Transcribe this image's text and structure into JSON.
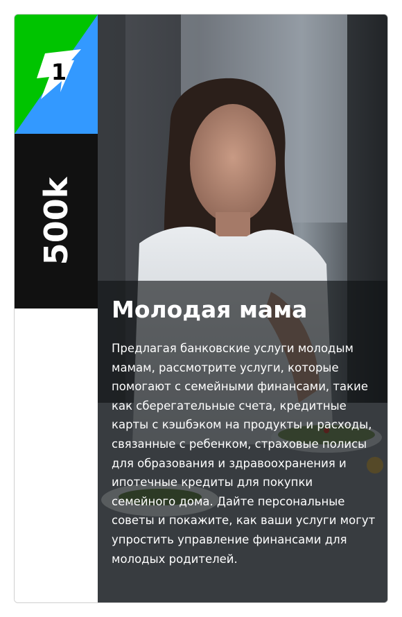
{
  "card": {
    "rank": "1",
    "value": "500k",
    "title": "Молодая мама",
    "description": "Предлагая банковские услуги молодым мамам, рассмотрите услуги, которые помогают с семейными финансами, такие как сберегательные счета, кредитные карты с кэшбэком на продукты и расходы, связанные с ребенком, страховые полисы для образования и здравоохранения и ипотечные кредиты для покупки семейного дома. Дайте персональные советы и покажите, как ваши услуги могут упростить управление финансами для молодых родителей.",
    "badge_colors": {
      "green": "#00c400",
      "blue": "#3399ff"
    },
    "icon": "lightning-icon",
    "photo_subject": "woman-cooking-photo"
  }
}
